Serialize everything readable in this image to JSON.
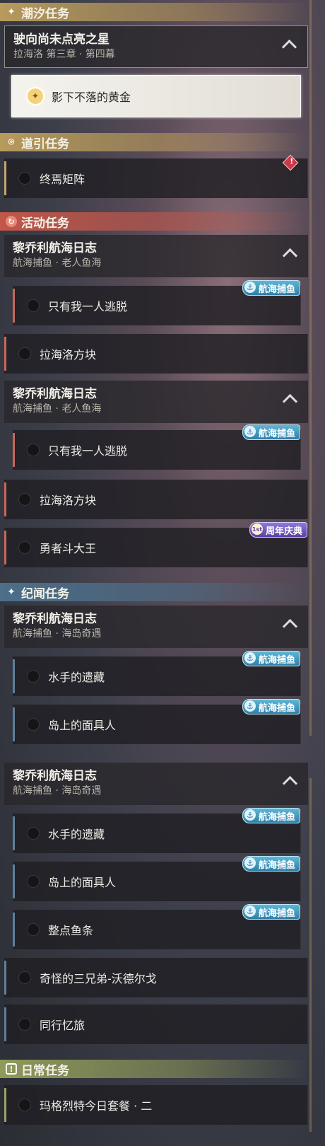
{
  "sections": {
    "tide": {
      "label": "潮汐任务",
      "icon": "sparkle-icon"
    },
    "guide": {
      "label": "道引任务",
      "icon": "location-pin-icon"
    },
    "event": {
      "label": "活动任务",
      "icon": "event-refresh-icon"
    },
    "record": {
      "label": "纪闻任务",
      "icon": "sparkle-icon"
    },
    "daily": {
      "label": "日常任务",
      "icon": "exclamation-icon"
    }
  },
  "tide_group": {
    "title": "驶向尚未点亮之星",
    "subtitle": "拉海洛 第三章 · 第四幕",
    "selected_task": "影下不落的黄金"
  },
  "guide_tasks": [
    {
      "label": "终焉矩阵",
      "badge": "!"
    }
  ],
  "event_groups": [
    {
      "title": "黎乔利航海日志",
      "subtitle": "航海捕鱼 · 老人鱼海",
      "tasks": [
        {
          "label": "只有我一人逃脱",
          "tag": "航海捕鱼"
        }
      ]
    },
    {
      "title": "黎乔利航海日志",
      "subtitle": "航海捕鱼 · 老人鱼海",
      "tasks": [
        {
          "label": "只有我一人逃脱",
          "tag": "航海捕鱼"
        }
      ]
    }
  ],
  "event_tasks_a": [
    {
      "label": "拉海洛方块"
    }
  ],
  "event_tasks_b": [
    {
      "label": "拉海洛方块"
    },
    {
      "label": "勇者斗大王",
      "tag": "周年庆典",
      "tag_prefix": "1st"
    }
  ],
  "record_groups": [
    {
      "title": "黎乔利航海日志",
      "subtitle": "航海捕鱼 · 海岛奇遇",
      "tasks": [
        {
          "label": "水手的遗藏",
          "tag": "航海捕鱼"
        },
        {
          "label": "岛上的面具人",
          "tag": "航海捕鱼"
        }
      ]
    },
    {
      "title": "黎乔利航海日志",
      "subtitle": "航海捕鱼 · 海岛奇遇",
      "tasks": [
        {
          "label": "水手的遗藏",
          "tag": "航海捕鱼"
        },
        {
          "label": "岛上的面具人",
          "tag": "航海捕鱼"
        },
        {
          "label": "整点鱼条",
          "tag": "航海捕鱼"
        }
      ]
    }
  ],
  "record_tasks": [
    {
      "label": "奇怪的三兄弟-沃德尔戈"
    },
    {
      "label": "同行忆旅"
    }
  ],
  "daily_tasks": [
    {
      "label": "玛格烈特今日套餐 · 二"
    }
  ],
  "colors": {
    "gold": "#c5a46a",
    "red": "#c86757",
    "blue": "#5d7f9a",
    "olive": "#9aa265",
    "tag_blue": "#2f7fa8"
  }
}
